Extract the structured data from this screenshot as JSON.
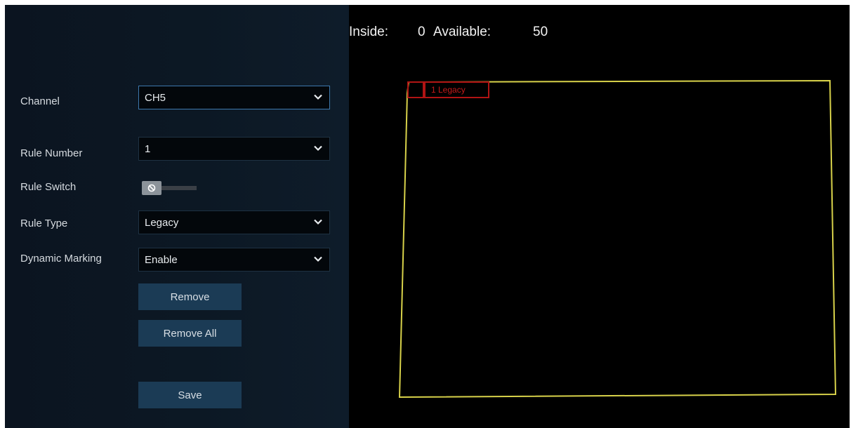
{
  "form": {
    "channel": {
      "label": "Channel",
      "value": "CH5"
    },
    "rule_number": {
      "label": "Rule Number",
      "value": "1"
    },
    "rule_switch": {
      "label": "Rule Switch",
      "state": "off"
    },
    "rule_type": {
      "label": "Rule Type",
      "value": "Legacy"
    },
    "dynamic_marking": {
      "label": "Dynamic Marking",
      "value": "Enable"
    }
  },
  "buttons": {
    "remove": "Remove",
    "remove_all": "Remove All",
    "save": "Save"
  },
  "preview": {
    "inside_label": "Inside:",
    "inside_value": "0",
    "available_label": "Available:",
    "available_value": "50",
    "rule_tag": "1 Legacy"
  },
  "colors": {
    "zone_outline": "#d8d24a",
    "rule_tag": "#b01414",
    "button_bg": "#1b3b55",
    "active_border": "#3d78ad"
  },
  "icons": {
    "dropdown": "chevron-down-icon",
    "toggle": "toggle-off-icon"
  }
}
